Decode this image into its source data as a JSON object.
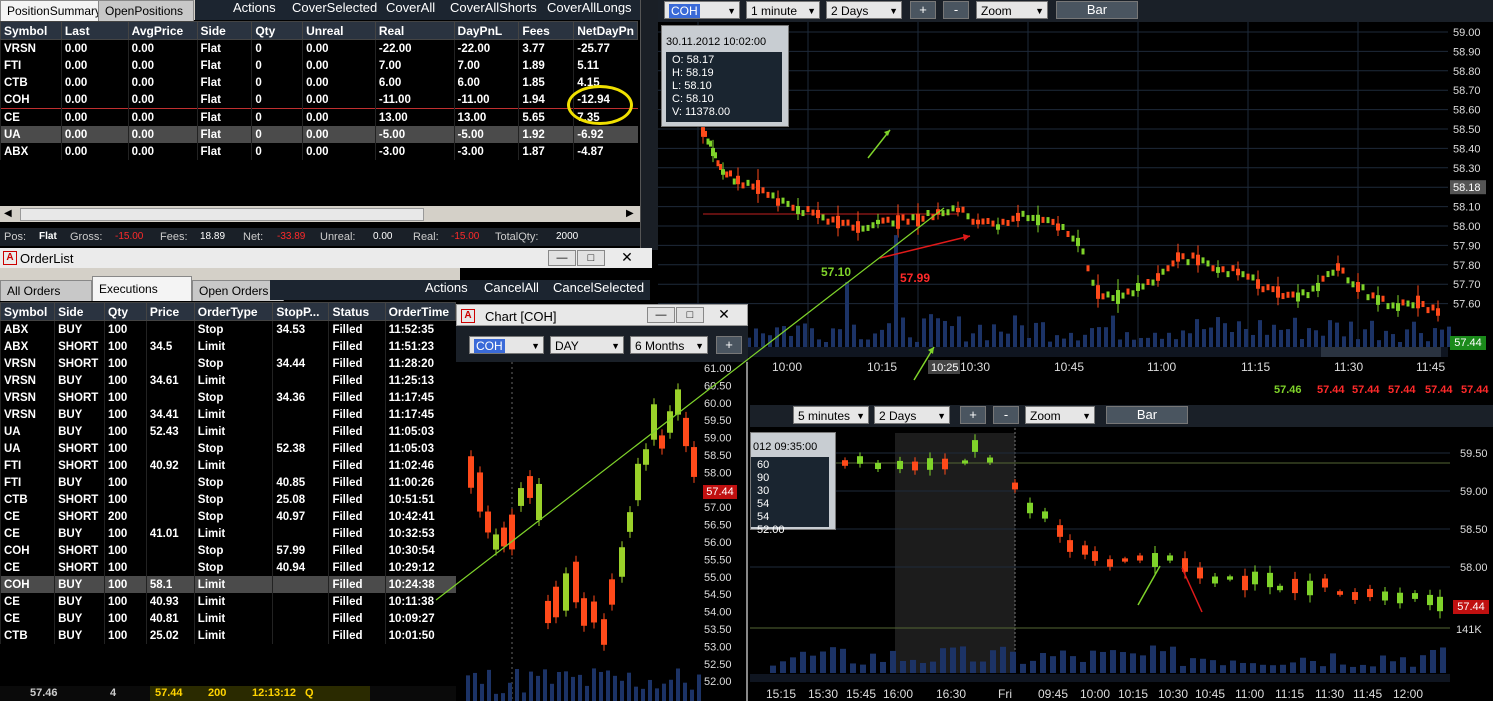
{
  "position_summary": {
    "tabs": [
      "PositionSummary",
      "OpenPositions"
    ],
    "actions": [
      "Actions",
      "CoverSelected",
      "CoverAll",
      "CoverAllShorts",
      "CoverAllLongs"
    ],
    "columns": [
      "Symbol",
      "Last",
      "AvgPrice",
      "Side",
      "Qty",
      "Unreal",
      "Real",
      "DayPnL",
      "Fees",
      "NetDayPn"
    ],
    "rows": [
      {
        "symbol": "VRSN",
        "last": "0.00",
        "avg": "0.00",
        "side": "Flat",
        "qty": "0",
        "unreal": "0.00",
        "real": "-22.00",
        "daypnl": "-22.00",
        "fees": "3.77",
        "net": "-25.77"
      },
      {
        "symbol": "FTI",
        "last": "0.00",
        "avg": "0.00",
        "side": "Flat",
        "qty": "0",
        "unreal": "0.00",
        "real": "7.00",
        "daypnl": "7.00",
        "fees": "1.89",
        "net": "5.11"
      },
      {
        "symbol": "CTB",
        "last": "0.00",
        "avg": "0.00",
        "side": "Flat",
        "qty": "0",
        "unreal": "0.00",
        "real": "6.00",
        "daypnl": "6.00",
        "fees": "1.85",
        "net": "4.15"
      },
      {
        "symbol": "COH",
        "last": "0.00",
        "avg": "0.00",
        "side": "Flat",
        "qty": "0",
        "unreal": "0.00",
        "real": "-11.00",
        "daypnl": "-11.00",
        "fees": "1.94",
        "net": "-12.94"
      },
      {
        "symbol": "CE",
        "last": "0.00",
        "avg": "0.00",
        "side": "Flat",
        "qty": "0",
        "unreal": "0.00",
        "real": "13.00",
        "daypnl": "13.00",
        "fees": "5.65",
        "net": "7.35"
      },
      {
        "symbol": "UA",
        "last": "0.00",
        "avg": "0.00",
        "side": "Flat",
        "qty": "0",
        "unreal": "0.00",
        "real": "-5.00",
        "daypnl": "-5.00",
        "fees": "1.92",
        "net": "-6.92"
      },
      {
        "symbol": "ABX",
        "last": "0.00",
        "avg": "0.00",
        "side": "Flat",
        "qty": "0",
        "unreal": "0.00",
        "real": "-3.00",
        "daypnl": "-3.00",
        "fees": "1.87",
        "net": "-4.87"
      }
    ],
    "status": {
      "pos_label": "Pos:",
      "pos": "Flat",
      "gross_label": "Gross:",
      "gross": "-15.00",
      "fees_label": "Fees:",
      "fees": "18.89",
      "net_label": "Net:",
      "net": "-33.89",
      "unreal_label": "Unreal:",
      "unreal": "0.00",
      "real_label": "Real:",
      "real": "-15.00",
      "totalqty_label": "TotalQty:",
      "totalqty": "2000"
    }
  },
  "order_list": {
    "title": "OrderList",
    "tabs": [
      "All Orders",
      "Executions",
      "Open Orders"
    ],
    "actions": [
      "Actions",
      "CancelAll",
      "CancelSelected"
    ],
    "columns": [
      "Symbol",
      "Side",
      "Qty",
      "Price",
      "OrderType",
      "StopP...",
      "Status",
      "OrderTime"
    ],
    "rows": [
      {
        "symbol": "ABX",
        "side": "BUY",
        "qty": "100",
        "price": "",
        "type": "Stop",
        "stop": "34.53",
        "status": "Filled",
        "time": "11:52:35"
      },
      {
        "symbol": "ABX",
        "side": "SHORT",
        "qty": "100",
        "price": "34.5",
        "type": "Limit",
        "stop": "",
        "status": "Filled",
        "time": "11:51:23"
      },
      {
        "symbol": "VRSN",
        "side": "SHORT",
        "qty": "100",
        "price": "",
        "type": "Stop",
        "stop": "34.44",
        "status": "Filled",
        "time": "11:28:20"
      },
      {
        "symbol": "VRSN",
        "side": "BUY",
        "qty": "100",
        "price": "34.61",
        "type": "Limit",
        "stop": "",
        "status": "Filled",
        "time": "11:25:13"
      },
      {
        "symbol": "VRSN",
        "side": "SHORT",
        "qty": "100",
        "price": "",
        "type": "Stop",
        "stop": "34.36",
        "status": "Filled",
        "time": "11:17:45"
      },
      {
        "symbol": "VRSN",
        "side": "BUY",
        "qty": "100",
        "price": "34.41",
        "type": "Limit",
        "stop": "",
        "status": "Filled",
        "time": "11:17:45"
      },
      {
        "symbol": "UA",
        "side": "BUY",
        "qty": "100",
        "price": "52.43",
        "type": "Limit",
        "stop": "",
        "status": "Filled",
        "time": "11:05:03"
      },
      {
        "symbol": "UA",
        "side": "SHORT",
        "qty": "100",
        "price": "",
        "type": "Stop",
        "stop": "52.38",
        "status": "Filled",
        "time": "11:05:03"
      },
      {
        "symbol": "FTI",
        "side": "SHORT",
        "qty": "100",
        "price": "40.92",
        "type": "Limit",
        "stop": "",
        "status": "Filled",
        "time": "11:02:46"
      },
      {
        "symbol": "FTI",
        "side": "BUY",
        "qty": "100",
        "price": "",
        "type": "Stop",
        "stop": "40.85",
        "status": "Filled",
        "time": "11:00:26"
      },
      {
        "symbol": "CTB",
        "side": "SHORT",
        "qty": "100",
        "price": "",
        "type": "Stop",
        "stop": "25.08",
        "status": "Filled",
        "time": "10:51:51"
      },
      {
        "symbol": "CE",
        "side": "SHORT",
        "qty": "200",
        "price": "",
        "type": "Stop",
        "stop": "40.97",
        "status": "Filled",
        "time": "10:42:41"
      },
      {
        "symbol": "CE",
        "side": "BUY",
        "qty": "100",
        "price": "41.01",
        "type": "Limit",
        "stop": "",
        "status": "Filled",
        "time": "10:32:53"
      },
      {
        "symbol": "COH",
        "side": "SHORT",
        "qty": "100",
        "price": "",
        "type": "Stop",
        "stop": "57.99",
        "status": "Filled",
        "time": "10:30:54"
      },
      {
        "symbol": "CE",
        "side": "SHORT",
        "qty": "100",
        "price": "",
        "type": "Stop",
        "stop": "40.94",
        "status": "Filled",
        "time": "10:29:12"
      },
      {
        "symbol": "COH",
        "side": "BUY",
        "qty": "100",
        "price": "58.1",
        "type": "Limit",
        "stop": "",
        "status": "Filled",
        "time": "10:24:38"
      },
      {
        "symbol": "CE",
        "side": "BUY",
        "qty": "100",
        "price": "40.93",
        "type": "Limit",
        "stop": "",
        "status": "Filled",
        "time": "10:11:38"
      },
      {
        "symbol": "CE",
        "side": "BUY",
        "qty": "100",
        "price": "40.81",
        "type": "Limit",
        "stop": "",
        "status": "Filled",
        "time": "10:09:27"
      },
      {
        "symbol": "CTB",
        "side": "BUY",
        "qty": "100",
        "price": "25.02",
        "type": "Limit",
        "stop": "",
        "status": "Filled",
        "time": "10:01:50"
      }
    ],
    "ticker_strip": {
      "last": "57.46",
      "size": "4",
      "price": "57.44",
      "qty": "200",
      "time": "12:13:12",
      "flag": "Q"
    }
  },
  "main_chart": {
    "symbol": "COH",
    "interval": "1 minute",
    "range": "2 Days",
    "zoom": "Zoom",
    "type": "Bar",
    "plus": "+",
    "minus": "-",
    "info": {
      "datetime": "30.11.2012 10:02:00",
      "o": "O: 58.17",
      "h": "H: 58.19",
      "l": "L: 58.10",
      "c": "C: 58.10",
      "v": "V: 11378.00"
    },
    "price_ticks": [
      "59.00",
      "58.90",
      "58.80",
      "58.70",
      "58.60",
      "58.50",
      "58.40",
      "58.30",
      "58.18",
      "58.10",
      "58.00",
      "57.90",
      "57.80",
      "57.70",
      "57.60"
    ],
    "last_price": "57.44",
    "time_ticks": [
      "10:00",
      "10:15",
      "10:25",
      "10:30",
      "10:45",
      "11:00",
      "11:15",
      "11:30",
      "11:45"
    ],
    "buy_label": "57.10",
    "sell_label": "57.99",
    "ticker_prices": [
      "57.46",
      "57.44",
      "57.44",
      "57.44",
      "57.44",
      "57.44"
    ]
  },
  "lower_chart": {
    "interval": "5 minutes",
    "range": "2 Days",
    "zoom": "Zoom",
    "type": "Bar",
    "plus": "+",
    "minus": "-",
    "info": {
      "datetime": "012 09:35:00",
      "lines": [
        "60",
        "90",
        "30",
        "54",
        "54",
        "52.00"
      ]
    },
    "price_ticks": [
      "59.50",
      "59.00",
      "58.50",
      "58.00"
    ],
    "last_price": "57.44",
    "volume_label": "141K",
    "time_ticks": [
      "15:15",
      "15:30",
      "15:45",
      "16:00",
      "16:30",
      "Fri",
      "09:45",
      "10:00",
      "10:15",
      "10:30",
      "10:45",
      "11:00",
      "11:15",
      "11:30",
      "11:45",
      "12:00"
    ]
  },
  "daily_chart": {
    "title": "Chart [COH]",
    "symbol": "COH",
    "interval": "DAY",
    "range": "6 Months",
    "plus": "+",
    "price_ticks": [
      "61.00",
      "60.50",
      "60.00",
      "59.50",
      "59.00",
      "58.50",
      "58.00",
      "57.50",
      "57.00",
      "56.50",
      "56.00",
      "55.50",
      "55.00",
      "54.50",
      "54.00",
      "53.50",
      "53.00",
      "52.50",
      "52.00"
    ],
    "last_price": "57.44"
  }
}
